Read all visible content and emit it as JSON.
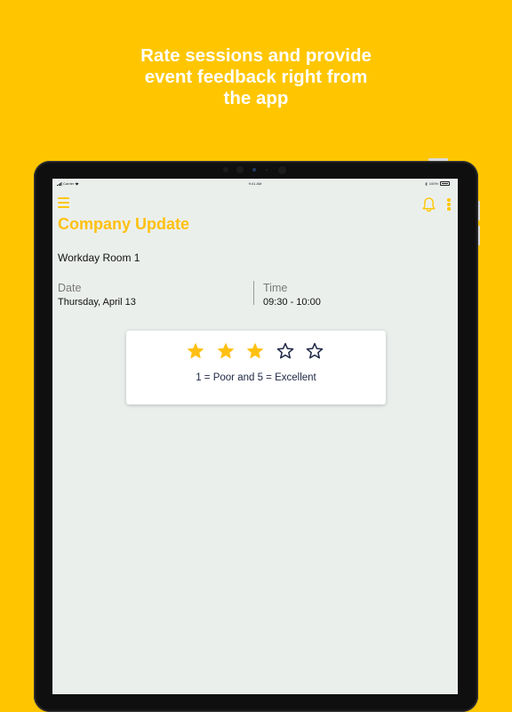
{
  "headline": {
    "line1": "Rate sessions and provide",
    "line2": "event feedback right from",
    "line3": "the app"
  },
  "status_bar": {
    "carrier": "Carrier",
    "time": "9:41 AM",
    "battery": "100%"
  },
  "app_bar": {
    "menu_icon": "hamburger-menu-icon",
    "notification_icon": "bell-icon",
    "more_icon": "vertical-dots-icon"
  },
  "session": {
    "title": "Company Update",
    "room": "Workday Room 1",
    "date_label": "Date",
    "date_value": "Thursday, April 13",
    "time_label": "Time",
    "time_value": "09:30 - 10:00"
  },
  "rating": {
    "max_stars": 5,
    "selected": 3,
    "caption": "1 = Poor and 5 = Excellent"
  },
  "colors": {
    "brand_yellow": "#FFC600",
    "star_filled": "#FFC012",
    "star_outline": "#1E2744",
    "screen_background": "#EBEFEC"
  }
}
